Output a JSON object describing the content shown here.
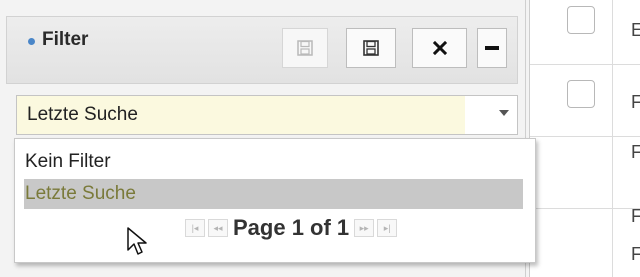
{
  "filter_panel": {
    "title": "Filter",
    "buttons": [
      {
        "name": "save-disabled-button",
        "icon": "floppy-disk-icon",
        "state": "disabled"
      },
      {
        "name": "save-button",
        "icon": "floppy-disk-icon"
      },
      {
        "name": "close-button",
        "icon": "close-icon"
      },
      {
        "name": "collapse-button",
        "icon": "minus-icon"
      }
    ]
  },
  "select": {
    "value": "Letzte Suche",
    "options": [
      "Kein Filter",
      "Letzte Suche"
    ],
    "highlighted_index": 1
  },
  "pager": {
    "label": "Page 1 of 1",
    "buttons": [
      "first-page-icon",
      "previous-page-icon",
      "next-page-icon",
      "last-page-icon"
    ]
  },
  "right_column": {
    "rows": [
      {
        "char": "E"
      },
      {
        "char": "F"
      },
      {
        "char": "F"
      },
      {
        "char": "F"
      },
      {
        "char": "F"
      }
    ]
  },
  "colors": {
    "accent_dot": "#4a86c8",
    "select_bg": "#fbf9df",
    "highlight": "#c8c8c8"
  }
}
